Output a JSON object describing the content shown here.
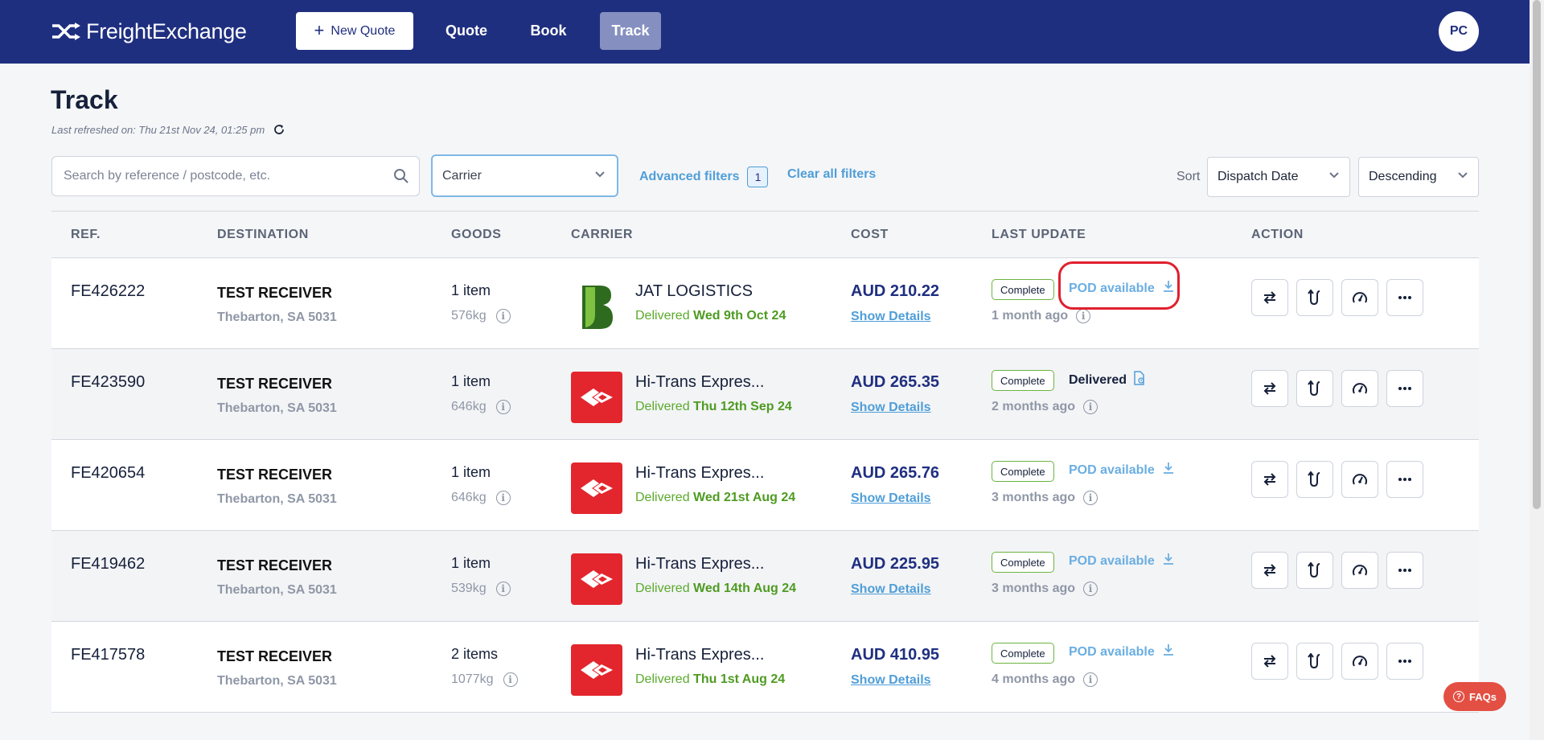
{
  "header": {
    "logo_text": "FreightExchange",
    "new_quote_label": "New Quote",
    "nav": {
      "quote": "Quote",
      "book": "Book",
      "track": "Track"
    },
    "avatar_initials": "PC",
    "brand_color": "#1f2f80"
  },
  "page": {
    "title": "Track",
    "last_refreshed": "Last refreshed on: Thu 21st Nov 24, 01:25 pm"
  },
  "filters": {
    "search_placeholder": "Search by reference / postcode, etc.",
    "carrier_placeholder": "Carrier",
    "advanced_label": "Advanced filters",
    "advanced_count": "1",
    "clear_label": "Clear all filters",
    "sort_label": "Sort",
    "sort_field": "Dispatch Date",
    "sort_order": "Descending"
  },
  "table": {
    "headers": {
      "ref": "REF.",
      "destination": "DESTINATION",
      "goods": "GOODS",
      "carrier": "CARRIER",
      "cost": "COST",
      "last_update": "LAST UPDATE",
      "action": "ACTION"
    },
    "rows": [
      {
        "ref": "FE426222",
        "dest_name": "TEST RECEIVER",
        "dest_loc": "Thebarton, SA 5031",
        "items": "1 item",
        "weight": "576kg",
        "carrier": "JAT LOGISTICS",
        "delivered_prefix": "Delivered",
        "delivered_date": "Wed 9th Oct 24",
        "cost": "AUD 210.22",
        "show_details": "Show Details",
        "status": "Complete",
        "doc_label": "POD available",
        "ago": "1 month ago"
      },
      {
        "ref": "FE423590",
        "dest_name": "TEST RECEIVER",
        "dest_loc": "Thebarton, SA 5031",
        "items": "1 item",
        "weight": "646kg",
        "carrier": "Hi-Trans Expres...",
        "delivered_prefix": "Delivered",
        "delivered_date": "Thu 12th Sep 24",
        "cost": "AUD 265.35",
        "show_details": "Show Details",
        "status": "Complete",
        "doc_label": "Delivered",
        "ago": "2 months ago"
      },
      {
        "ref": "FE420654",
        "dest_name": "TEST RECEIVER",
        "dest_loc": "Thebarton, SA 5031",
        "items": "1 item",
        "weight": "646kg",
        "carrier": "Hi-Trans Expres...",
        "delivered_prefix": "Delivered",
        "delivered_date": "Wed 21st Aug 24",
        "cost": "AUD 265.76",
        "show_details": "Show Details",
        "status": "Complete",
        "doc_label": "POD available",
        "ago": "3 months ago"
      },
      {
        "ref": "FE419462",
        "dest_name": "TEST RECEIVER",
        "dest_loc": "Thebarton, SA 5031",
        "items": "1 item",
        "weight": "539kg",
        "carrier": "Hi-Trans Expres...",
        "delivered_prefix": "Delivered",
        "delivered_date": "Wed 14th Aug 24",
        "cost": "AUD 225.95",
        "show_details": "Show Details",
        "status": "Complete",
        "doc_label": "POD available",
        "ago": "3 months ago"
      },
      {
        "ref": "FE417578",
        "dest_name": "TEST RECEIVER",
        "dest_loc": "Thebarton, SA 5031",
        "items": "2 items",
        "weight": "1077kg",
        "carrier": "Hi-Trans Expres...",
        "delivered_prefix": "Delivered",
        "delivered_date": "Thu 1st Aug 24",
        "cost": "AUD 410.95",
        "show_details": "Show Details",
        "status": "Complete",
        "doc_label": "POD available",
        "ago": "4 months ago"
      }
    ]
  },
  "faq_label": "FAQs"
}
